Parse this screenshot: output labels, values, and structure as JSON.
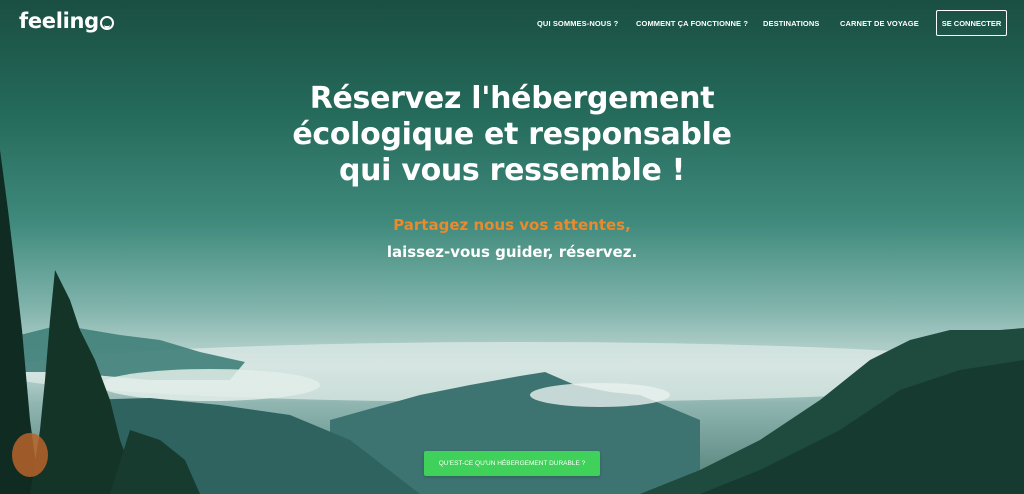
{
  "brand": {
    "name": "feeling"
  },
  "nav": {
    "items": [
      {
        "label": "QUI SOMMES-NOUS ?"
      },
      {
        "label": "COMMENT ÇA FONCTIONNE ?"
      },
      {
        "label": "DESTINATIONS"
      },
      {
        "label": "CARNET DE VOYAGE"
      }
    ],
    "login_label": "SE CONNECTER"
  },
  "hero": {
    "headline": "Réservez l'hébergement écologique et responsable qui vous ressemble !",
    "tagline_orange": "Partagez nous vos attentes,",
    "tagline_white": "laissez-vous guider, réservez.",
    "cta_label": "QU'EST-CE QU'UN HÉBERGEMENT DURABLE ?"
  },
  "colors": {
    "accent_orange": "#e98a2c",
    "cta_green": "#3fd15a",
    "sky_top": "#1a4f42"
  }
}
